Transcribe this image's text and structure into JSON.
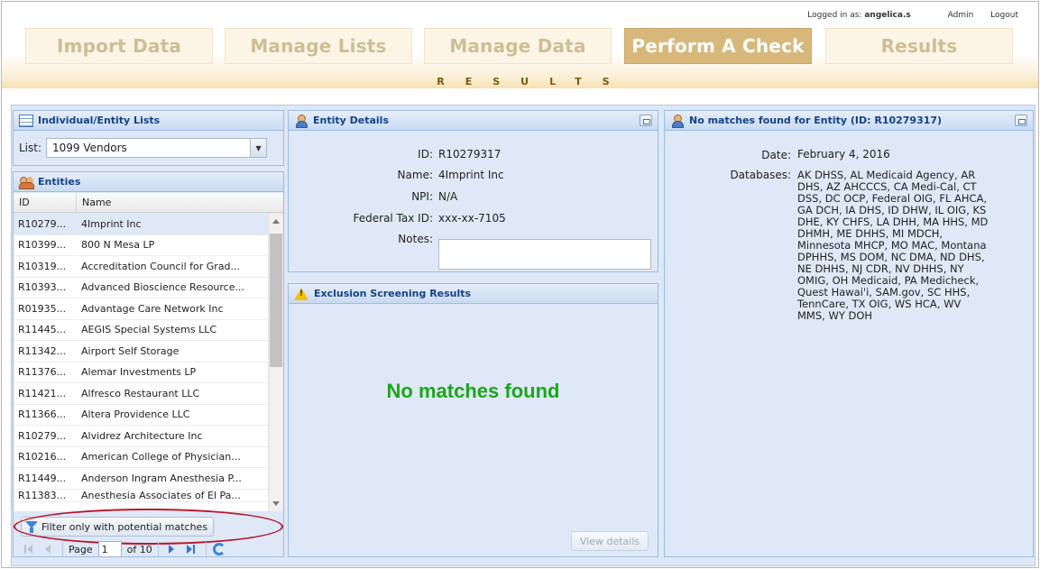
{
  "user": {
    "prefix": "Logged in as:",
    "name": "angelica.s",
    "admin": "Admin",
    "logout": "Logout"
  },
  "nav": [
    "Import Data",
    "Manage Lists",
    "Manage Data",
    "Perform A Check",
    "Results"
  ],
  "nav_active": "Perform A Check",
  "section_title": "RESULTS",
  "lists_panel": {
    "title": "Individual/Entity Lists",
    "list_label": "List:",
    "list_value": "1099 Vendors"
  },
  "entities_panel": {
    "title": "Entities",
    "columns": [
      "ID",
      "Name"
    ],
    "rows": [
      [
        "R10279...",
        "4Imprint Inc"
      ],
      [
        "R10399...",
        "800 N Mesa LP"
      ],
      [
        "R10319...",
        "Accreditation Council for Grad..."
      ],
      [
        "R10393...",
        "Advanced Bioscience Resource..."
      ],
      [
        "R01935...",
        "Advantage Care Network Inc"
      ],
      [
        "R11445...",
        "AEGIS Special Systems LLC"
      ],
      [
        "R11342...",
        "Airport Self Storage"
      ],
      [
        "R11376...",
        "Alemar Investments LP"
      ],
      [
        "R11421...",
        "Alfresco Restaurant LLC"
      ],
      [
        "R11366...",
        "Altera Providence LLC"
      ],
      [
        "R10279...",
        "Alvidrez Architecture Inc"
      ],
      [
        "R10216...",
        "American College of Physician..."
      ],
      [
        "R11449...",
        "Anderson Ingram Anesthesia P..."
      ],
      [
        "R11383...",
        "Anesthesia Associates of El Pa..."
      ]
    ],
    "filter_label": "Filter only with potential matches",
    "pager": {
      "page_label": "Page",
      "page": "1",
      "of_label": "of 10"
    }
  },
  "entity_details": {
    "title": "Entity Details",
    "fields": [
      {
        "label": "ID:",
        "value": "R10279317"
      },
      {
        "label": "Name:",
        "value": "4Imprint Inc"
      },
      {
        "label": "NPI:",
        "value": "N/A"
      },
      {
        "label": "Federal Tax ID:",
        "value": "xxx-xx-7105"
      },
      {
        "label": "Notes:",
        "value": ""
      }
    ]
  },
  "exclusion": {
    "title": "Exclusion Screening Results",
    "message": "No matches found",
    "view_details": "View details"
  },
  "right_panel": {
    "title": "No matches found for Entity (ID: R10279317)",
    "date_label": "Date:",
    "date_value": "February 4, 2016",
    "databases_label": "Databases:",
    "databases_lines": [
      "AK DHSS, AL Medicaid Agency, AR",
      "DHS, AZ AHCCCS, CA Medi-Cal, CT",
      "DSS, DC OCP, Federal OIG, FL AHCA,",
      "GA DCH, IA DHS, ID DHW, IL OIG, KS",
      "DHE, KY CHFS, LA DHH, MA HHS, MD",
      "DHMH, ME DHHS, MI MDCH,",
      "Minnesota MHCP, MO MAC, Montana",
      "DPHHS, MS DOM, NC DMA, ND DHS,",
      "NE DHHS, NJ CDR, NV DHHS, NY",
      "OMIG, OH Medicaid, PA Medicheck,",
      "Quest Hawai'i, SAM.gov, SC HHS,",
      "TennCare, TX OIG, WS HCA, WV",
      "MMS, WY DOH"
    ]
  }
}
